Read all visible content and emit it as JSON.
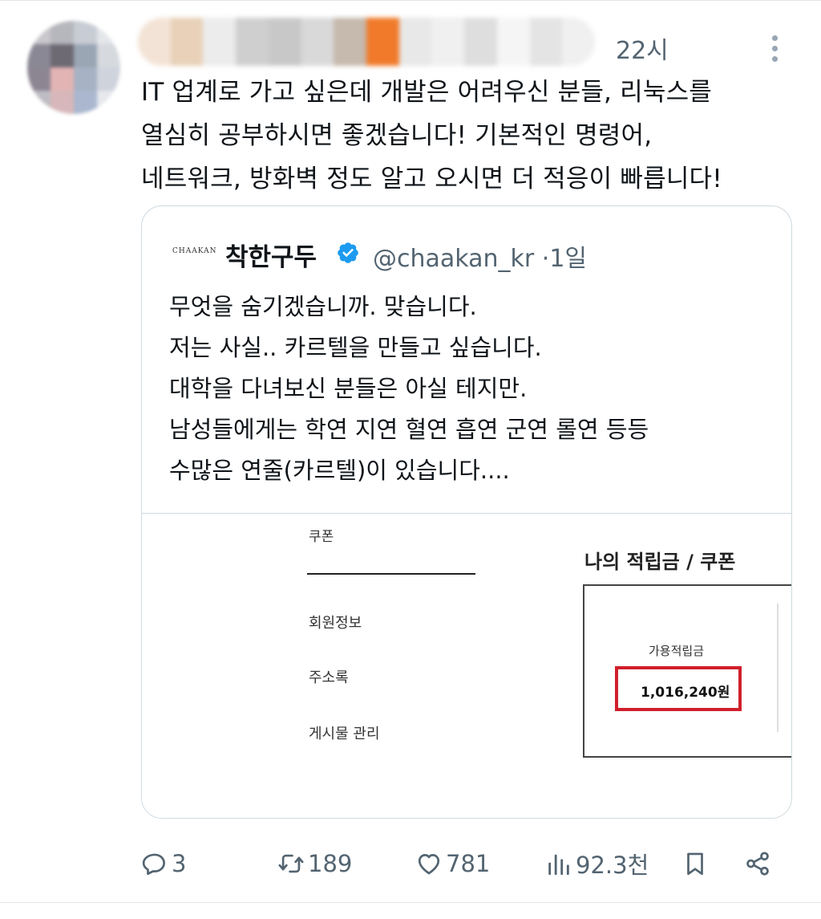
{
  "tweet": {
    "time": "22시",
    "text_lines": [
      "IT 업계로 가고 싶은데 개발은 어려우신 분들, 리눅스를",
      "열심히 공부하시면 좋겠습니다! 기본적인 명령어,",
      "네트워크, 방화벽 정도 알고 오시면 더 적응이 빠릅니다!"
    ]
  },
  "quote": {
    "logo_text": "CHAAKAN",
    "name": "착한구두",
    "handle": "@chaakan_kr",
    "separator": "·",
    "time": "1일",
    "text_lines": [
      "무엇을 숨기겠습니까. 맞습니다.",
      "저는 사실.. 카르텔을 만들고 싶습니다.",
      "대학을 다녀보신 분들은 아실 테지만.",
      "남성들에게는 학연 지연 혈연 흡연 군연 롤연 등등",
      "수많은 연줄(카르텔)이 있습니다...."
    ],
    "media": {
      "coupon_label": "쿠폰",
      "menu": [
        "회원정보",
        "주소록",
        "게시물 관리"
      ],
      "title": "나의 적립금 / 쿠폰",
      "points_label": "가용적립금",
      "points_value": "1,016,240원"
    }
  },
  "actions": {
    "replies": "3",
    "retweets": "189",
    "likes": "781",
    "views": "92.3천"
  },
  "colors": {
    "text": "#0f1419",
    "secondary": "#536471",
    "verified": "#1d9bf0",
    "highlight_red": "#d0202a",
    "border": "#cfd9de"
  },
  "icons": [
    "more-icon",
    "verified-badge-icon",
    "reply-icon",
    "retweet-icon",
    "like-icon",
    "views-icon",
    "bookmark-icon",
    "share-icon"
  ]
}
